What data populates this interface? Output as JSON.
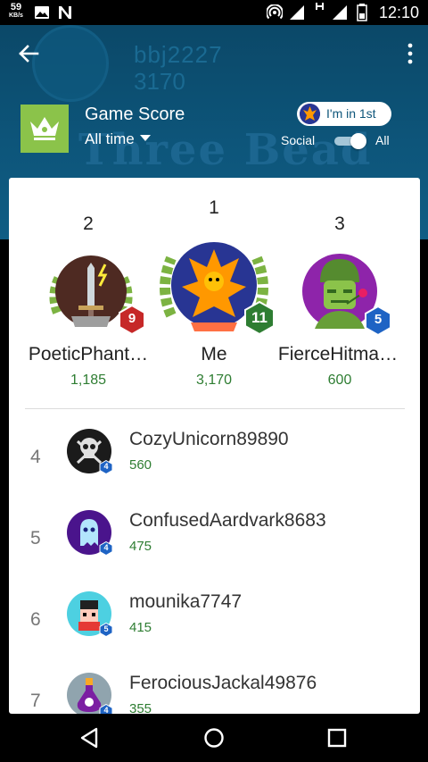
{
  "status": {
    "speed_value": "59",
    "speed_unit": "KB/s",
    "time": "12:10"
  },
  "header": {
    "bg_name": "bbj2227",
    "bg_score": "3170",
    "bg_title": "Three Bead",
    "title": "Game Score",
    "time_filter": "All time",
    "rank_pill": "I'm in 1st",
    "toggle_left": "Social",
    "toggle_right": "All",
    "accent_color": "#8bc34a"
  },
  "podium": [
    {
      "rank": "2",
      "name": "PoeticPhant…",
      "score": "1,185",
      "level": "9",
      "badge_color": "#c62828",
      "badge_shape": "hexagon"
    },
    {
      "rank": "1",
      "name": "Me",
      "score": "3,170",
      "level": "11",
      "badge_color": "#2e7d32",
      "badge_shape": "hexagon"
    },
    {
      "rank": "3",
      "name": "FierceHitma…",
      "score": "600",
      "level": "5",
      "badge_color": "#1e63c4",
      "badge_shape": "hexagon"
    }
  ],
  "rows": [
    {
      "rank": "4",
      "name": "CozyUnicorn89890",
      "score": "560",
      "level": "4",
      "avatar": "skull-avatar"
    },
    {
      "rank": "5",
      "name": "ConfusedAardvark8683",
      "score": "475",
      "level": "4",
      "avatar": "ghost-avatar"
    },
    {
      "rank": "6",
      "name": "mounika7747",
      "score": "415",
      "level": "5",
      "avatar": "robot-avatar"
    },
    {
      "rank": "7",
      "name": "FerociousJackal49876",
      "score": "355",
      "level": "4",
      "avatar": "potion-avatar"
    }
  ]
}
